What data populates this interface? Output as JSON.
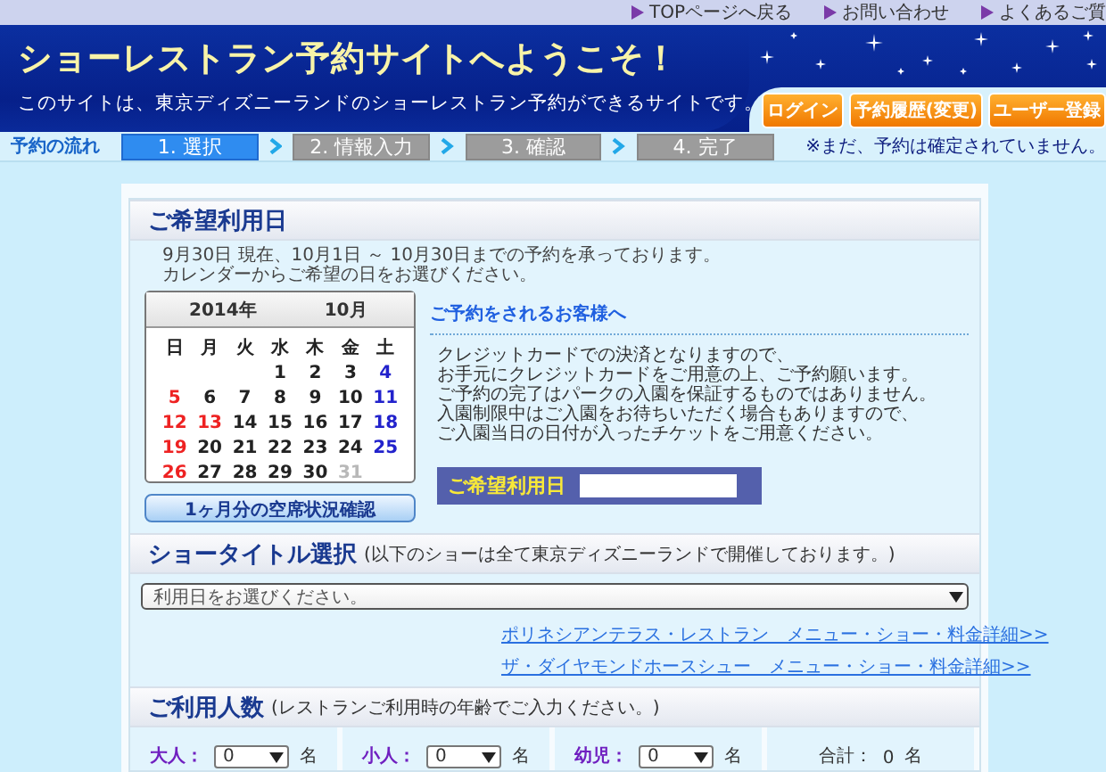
{
  "top_links": [
    {
      "label": "TOPページへ戻る"
    },
    {
      "label": "お問い合わせ"
    },
    {
      "label": "よくあるご質"
    }
  ],
  "header": {
    "title": "ショーレストラン予約サイトへようこそ！",
    "subtitle": "このサイトは、東京ディズニーランドのショーレストラン予約ができるサイトです。",
    "buttons": [
      {
        "label": "ログイン"
      },
      {
        "label": "予約履歴",
        "note": "(変更)"
      },
      {
        "label": "ユーザー登録"
      }
    ]
  },
  "flow": {
    "label": "予約の流れ",
    "steps": [
      {
        "label": "1. 選択",
        "selected": true
      },
      {
        "label": "2. 情報入力",
        "selected": false
      },
      {
        "label": "3. 確認",
        "selected": false
      },
      {
        "label": "4. 完了",
        "selected": false
      }
    ],
    "notice": "※まだ、予約は確定されていません。"
  },
  "date_section": {
    "title": "ご希望利用日",
    "notes": [
      "9月30日  現在、10月1日  ～  10月30日までの予約を承っております。",
      "カレンダーからご希望の日をお選びください。"
    ],
    "calendar": {
      "year": "2014年",
      "month": "10月",
      "weekdays": [
        "日",
        "月",
        "火",
        "水",
        "木",
        "金",
        "土"
      ],
      "weeks": [
        [
          {
            "kind": "blank"
          },
          {
            "kind": "blank"
          },
          {
            "kind": "blank"
          },
          {
            "day": "1",
            "kind": "weekday"
          },
          {
            "day": "2",
            "kind": "weekday"
          },
          {
            "day": "3",
            "kind": "weekday"
          },
          {
            "day": "4",
            "kind": "saturday"
          }
        ],
        [
          {
            "day": "5",
            "kind": "holiday"
          },
          {
            "day": "6",
            "kind": "weekday"
          },
          {
            "day": "7",
            "kind": "weekday"
          },
          {
            "day": "8",
            "kind": "weekday"
          },
          {
            "day": "9",
            "kind": "weekday"
          },
          {
            "day": "10",
            "kind": "weekday"
          },
          {
            "day": "11",
            "kind": "saturday"
          }
        ],
        [
          {
            "day": "12",
            "kind": "holiday"
          },
          {
            "day": "13",
            "kind": "holiday"
          },
          {
            "day": "14",
            "kind": "weekday"
          },
          {
            "day": "15",
            "kind": "weekday"
          },
          {
            "day": "16",
            "kind": "weekday"
          },
          {
            "day": "17",
            "kind": "weekday"
          },
          {
            "day": "18",
            "kind": "saturday"
          }
        ],
        [
          {
            "day": "19",
            "kind": "holiday"
          },
          {
            "day": "20",
            "kind": "weekday"
          },
          {
            "day": "21",
            "kind": "weekday"
          },
          {
            "day": "22",
            "kind": "weekday"
          },
          {
            "day": "23",
            "kind": "weekday"
          },
          {
            "day": "24",
            "kind": "weekday"
          },
          {
            "day": "25",
            "kind": "saturday"
          }
        ],
        [
          {
            "day": "26",
            "kind": "holiday"
          },
          {
            "day": "27",
            "kind": "weekday"
          },
          {
            "day": "28",
            "kind": "weekday"
          },
          {
            "day": "29",
            "kind": "weekday"
          },
          {
            "day": "30",
            "kind": "weekday"
          },
          {
            "day": "31",
            "kind": "unavailable"
          },
          {
            "kind": "blank"
          }
        ]
      ]
    },
    "availability_button": "1ヶ月分の空席状況確認",
    "info_title": "ご予約をされるお客様へ",
    "info_lines": [
      "クレジットカードでの決済となりますので、",
      "お手元にクレジットカードをご用意の上、ご予約願います。",
      "ご予約の完了はパークの入園を保証するものではありません。",
      "入園制限中はご入園をお待ちいただく場合もありますので、",
      "ご入園当日の日付が入ったチケットをご用意ください。"
    ],
    "date_field_label": "ご希望利用日"
  },
  "show_section": {
    "title": "ショータイトル選択",
    "note": "(以下のショーは全て東京ディズニーランドで開催しております。)",
    "select_placeholder": "利用日をお選びください。",
    "links": [
      "ポリネシアンテラス・レストラン　メニュー・ショー・料金詳細>>",
      "ザ・ダイヤモンドホースシュー　メニュー・ショー・料金詳細>>"
    ]
  },
  "people_section": {
    "title": "ご利用人数",
    "note": "(レストランご利用時の年齢でご入力ください。)",
    "counts": [
      {
        "label": "大人：",
        "value": "0",
        "unit": "名"
      },
      {
        "label": "小人：",
        "value": "0",
        "unit": "名"
      },
      {
        "label": "幼児：",
        "value": "0",
        "unit": "名"
      }
    ],
    "total": {
      "label": "合計：",
      "value": "0",
      "unit": "名"
    }
  }
}
